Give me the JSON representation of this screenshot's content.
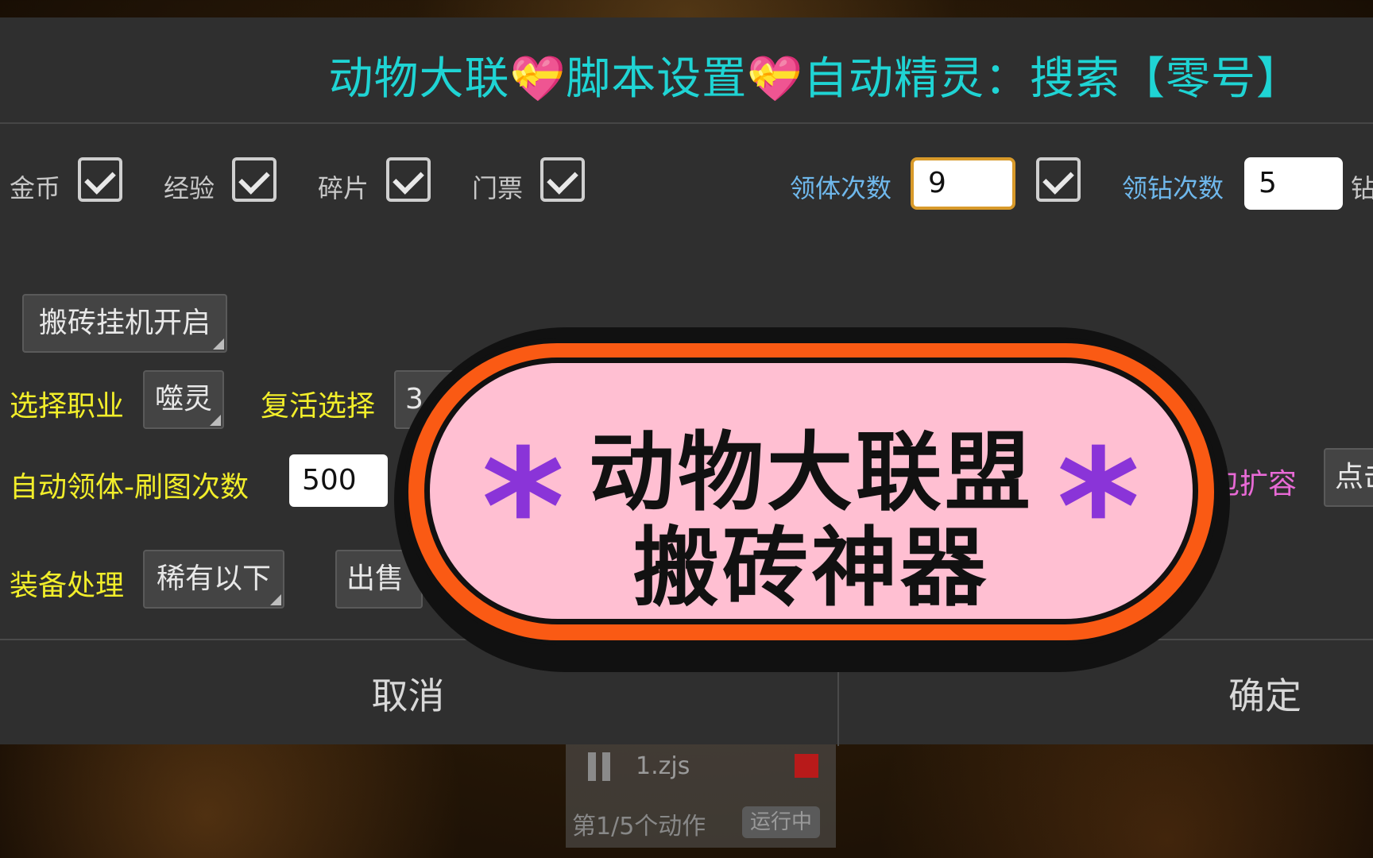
{
  "title": {
    "part1": "动物大联",
    "heart": "💝",
    "part2": "脚本设置",
    "part3": "自动精灵：搜索【零号】"
  },
  "checks": {
    "gold": {
      "label": "金币",
      "checked": true
    },
    "exp": {
      "label": "经验",
      "checked": true
    },
    "fragment": {
      "label": "碎片",
      "checked": true
    },
    "ticket": {
      "label": "门票",
      "checked": true
    }
  },
  "stamina": {
    "label": "领体次数",
    "value": "9",
    "checked": true
  },
  "diamond": {
    "label": "领钻次数",
    "value": "5",
    "trailing": "钻"
  },
  "afk_button": {
    "label": "搬砖挂机开启"
  },
  "job": {
    "label": "选择职业",
    "value": "噬灵"
  },
  "revive": {
    "label": "复活选择",
    "value": "3"
  },
  "auto_stamina": {
    "label": "自动领体-刷图次数",
    "value": "500"
  },
  "bag": {
    "label": "包扩容",
    "button": "点击"
  },
  "equip": {
    "label": "装备处理",
    "value": "稀有以下",
    "action": "出售"
  },
  "footer": {
    "cancel": "取消",
    "confirm": "确定"
  },
  "runner": {
    "file": "1.zjs",
    "status": "第1/5个动作",
    "badge": "运行中"
  },
  "banner": {
    "line1": "动物大联盟",
    "line2": "搬砖神器",
    "star": "*"
  },
  "colors": {
    "title": "#1fd4d4",
    "yellow_label": "#f2ee2a",
    "blue_label": "#6fb8ec",
    "pink_label": "#e86ad6",
    "banner_orange": "#fa5a14",
    "banner_pink": "#ffbfd2",
    "asterisk": "#8a34d8"
  }
}
